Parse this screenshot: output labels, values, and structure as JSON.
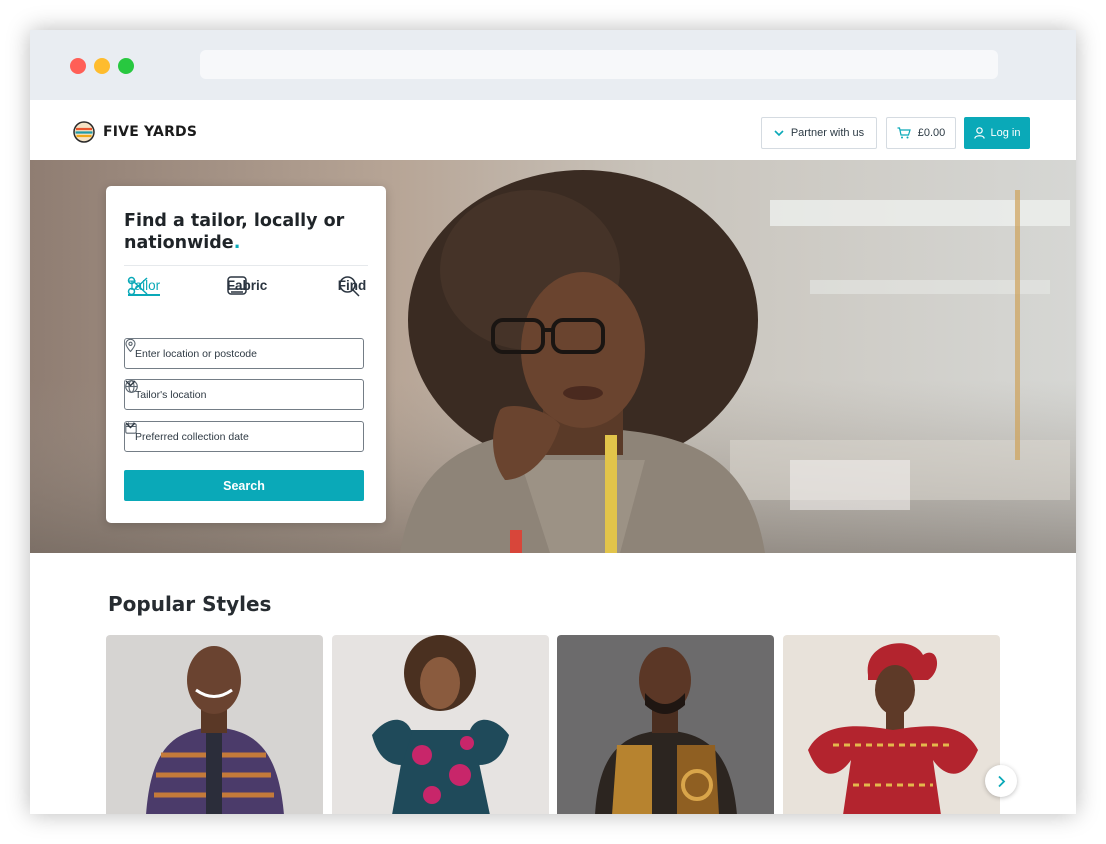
{
  "brand": {
    "name": "FIVE YARDS"
  },
  "nav": {
    "partner_label": "Partner with us",
    "cart_total": "£0.00",
    "login_label": "Log in"
  },
  "search_card": {
    "title": "Find a tailor, locally or nationwide",
    "title_punct": ".",
    "modes": [
      "Tailor",
      "Fabric",
      "Find"
    ],
    "active_mode": "Tailor",
    "location_placeholder": "Enter location or postcode",
    "tailor_location": "Tailor's location",
    "collection_date": "Preferred collection date",
    "search_label": "Search"
  },
  "popular": {
    "title": "Popular Styles",
    "cards": [
      {
        "icon": "man-patterned-shirt-photo"
      },
      {
        "icon": "woman-print-dress-photo"
      },
      {
        "icon": "man-print-shirt-photo"
      },
      {
        "icon": "woman-red-headwrap-photo"
      }
    ]
  },
  "colors": {
    "accent": "#0aa9b8",
    "text": "#1f2428",
    "border": "#d5dbe1"
  },
  "icons": {
    "partner": "chevron-down-icon",
    "cart": "cart-icon",
    "login": "user-icon",
    "location": "map-pin-icon",
    "globe": "globe-icon",
    "calendar": "calendar-icon",
    "next": "chevron-right-icon"
  }
}
